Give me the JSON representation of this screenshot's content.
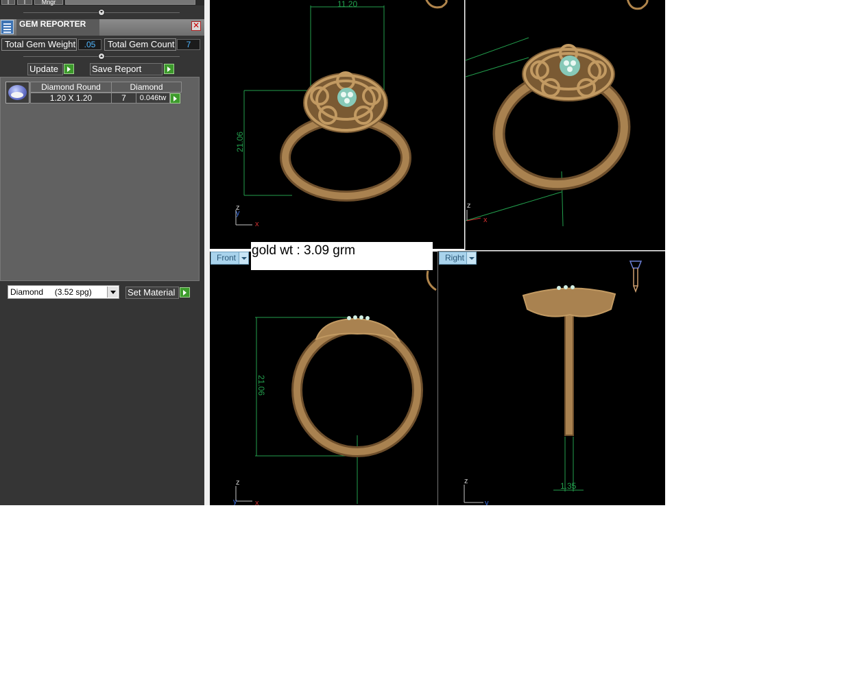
{
  "toolbar": {
    "small_button_1": "I",
    "small_button_2": "I",
    "small_button_3": "Mngr"
  },
  "panel": {
    "title": "GEM REPORTER",
    "close_glyph": "✕",
    "total_gem_weight_label": "Total Gem Weight",
    "total_gem_weight_value": ".05",
    "total_gem_count_label": "Total Gem Count",
    "total_gem_count_value": "7",
    "update_label": "Update",
    "save_report_label": "Save Report",
    "gem_table": {
      "header_cut": "Diamond Round",
      "header_material": "Diamond",
      "size": "1.20 X 1.20",
      "count": "7",
      "weight": "0.046tw"
    },
    "material_select_value": "Diamond     (3.52 spg)",
    "set_material_label": "Set Material"
  },
  "viewports": {
    "front_label": "Front",
    "right_label": "Right",
    "top_dim_width": "11.20",
    "top_dim_height": "21.06",
    "front_dim_height": "21.06",
    "right_dim_thickness": "1.35",
    "axis_x": "x",
    "axis_y": "y",
    "axis_z": "z"
  },
  "note": {
    "gold_weight": "gold wt : 3.09 grm"
  },
  "colors": {
    "viewport_bg": "#000000",
    "metal_gold": "#a17a47",
    "dimension_green": "#23a14e",
    "tab_blue": "#a9d3ec"
  }
}
